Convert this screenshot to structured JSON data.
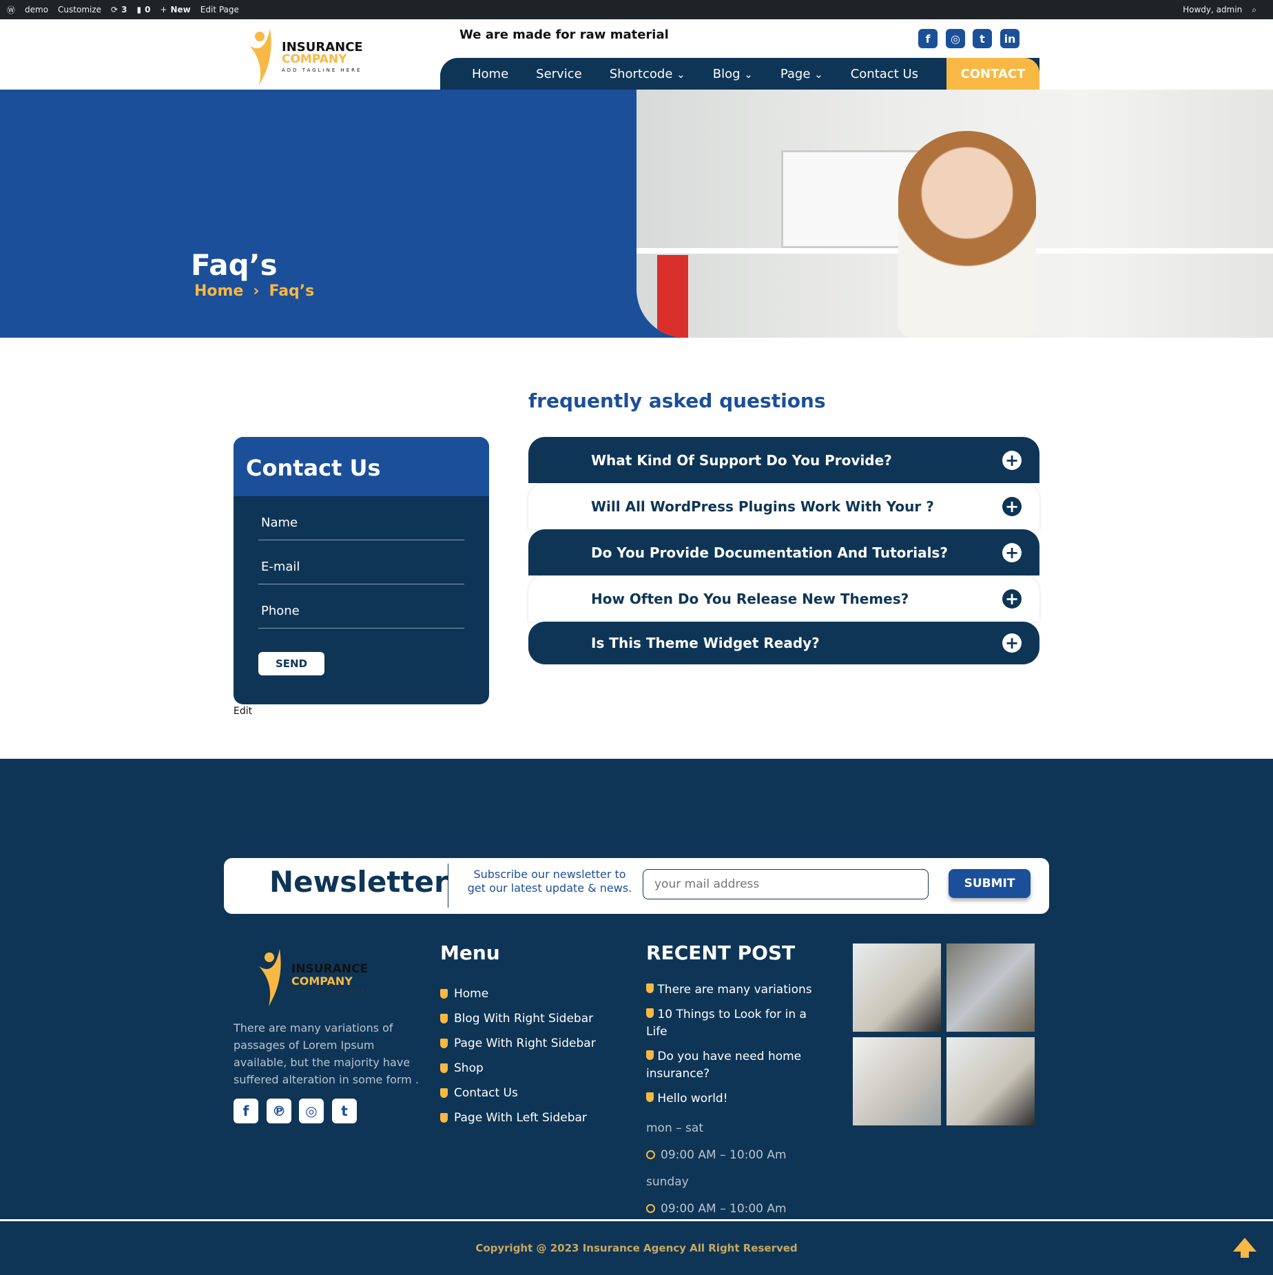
{
  "adminbar": {
    "items": [
      "demo",
      "Customize",
      "3",
      "0",
      "New",
      "Edit Page"
    ],
    "howdy": "Howdy, admin"
  },
  "header": {
    "tagline": "We are made for raw material",
    "logo": {
      "line1": "INSURANCE",
      "line2": "COMPANY",
      "line3": "ADD TAGLINE HERE"
    },
    "social": [
      "facebook-icon",
      "instagram-icon",
      "twitter-icon",
      "linkedin-icon"
    ],
    "nav": [
      {
        "label": "Home"
      },
      {
        "label": "Service"
      },
      {
        "label": "Shortcode",
        "dropdown": true
      },
      {
        "label": "Blog",
        "dropdown": true
      },
      {
        "label": "Page",
        "dropdown": true
      },
      {
        "label": "Contact Us"
      }
    ],
    "cta": "CONTACT"
  },
  "hero": {
    "title": "Faq’s",
    "breadcrumb": [
      "Home",
      "Faq’s"
    ]
  },
  "faq": {
    "heading": "frequently asked questions",
    "items": [
      "What Kind Of Support Do You Provide?",
      "Will All WordPress Plugins Work With Your ?",
      "Do You Provide Documentation And Tutorials?",
      "How Often Do You Release New Themes?",
      "Is This Theme Widget Ready?"
    ]
  },
  "contact": {
    "title": "Contact Us",
    "fields": [
      "Name",
      "E-mail",
      "Phone"
    ],
    "send": "SEND",
    "edit": "Edit"
  },
  "newsletter": {
    "title": "Newsletter",
    "subtitle": "Subscribe our newsletter to get our latest update & news.",
    "placeholder": "your mail address",
    "submit": "SUBMIT"
  },
  "footer": {
    "about": "There are many variations of passages of Lorem Ipsum available, but the majority have suffered alteration in some form .",
    "social": [
      "facebook-icon",
      "pinterest-icon",
      "instagram-icon",
      "twitter-icon"
    ],
    "menu_title": "Menu",
    "menu": [
      "Home",
      "Blog With Right Sidebar",
      "Page With Right Sidebar",
      "Shop",
      "Contact Us",
      "Page With Left Sidebar"
    ],
    "recent_title": "RECENT POST",
    "recent": [
      "There are many variations",
      "10 Things to Look for in a Life",
      "Do you have need home insurance?",
      "Hello world!"
    ],
    "hours": [
      {
        "days": "mon – sat",
        "time": "09:00 AM – 10:00 Am"
      },
      {
        "days": "sunday",
        "time": "09:00 AM – 10:00 Am"
      }
    ],
    "copyright": "Copyright @ 2023 Insurance Agency All Right Reserved"
  },
  "colors": {
    "navy": "#0e3556",
    "blue": "#1b4f99",
    "accent": "#f9b843"
  }
}
